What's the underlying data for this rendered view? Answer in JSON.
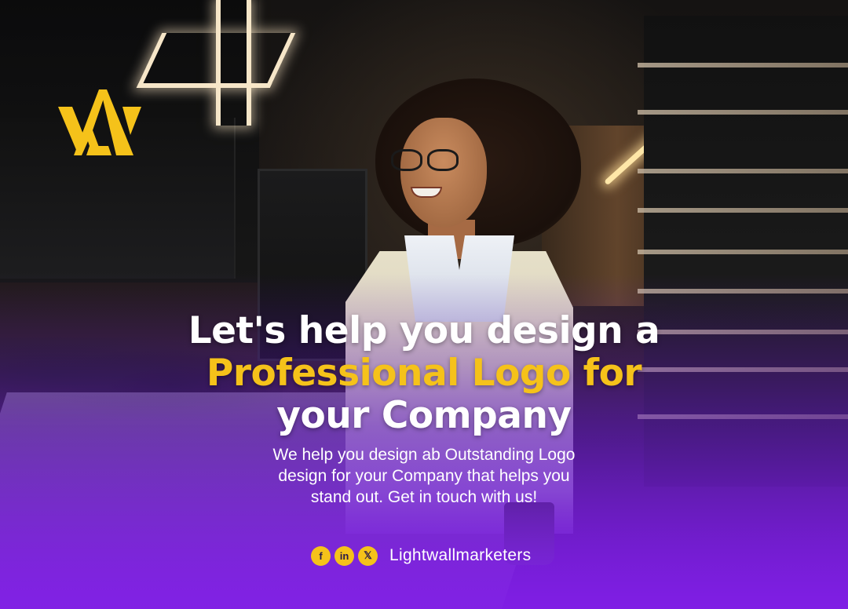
{
  "brand": {
    "logo_icon": "lightwall-logo",
    "accent_color": "#f5c21a",
    "background_gradient_color": "#7a1fd8"
  },
  "headline": {
    "line1": "Let's help you design a",
    "line2": "Professional Logo for",
    "line3": "your Company"
  },
  "subtext": {
    "line1": "We help you design ab Outstanding Logo",
    "line2": "design for your Company that helps you",
    "line3": "stand out. Get in touch with us!"
  },
  "social": {
    "icons": [
      {
        "name": "facebook-icon",
        "glyph": "f"
      },
      {
        "name": "linkedin-icon",
        "glyph": "in"
      },
      {
        "name": "x-twitter-icon",
        "glyph": "𝕏"
      }
    ],
    "handle": "Lightwallmarketers"
  }
}
